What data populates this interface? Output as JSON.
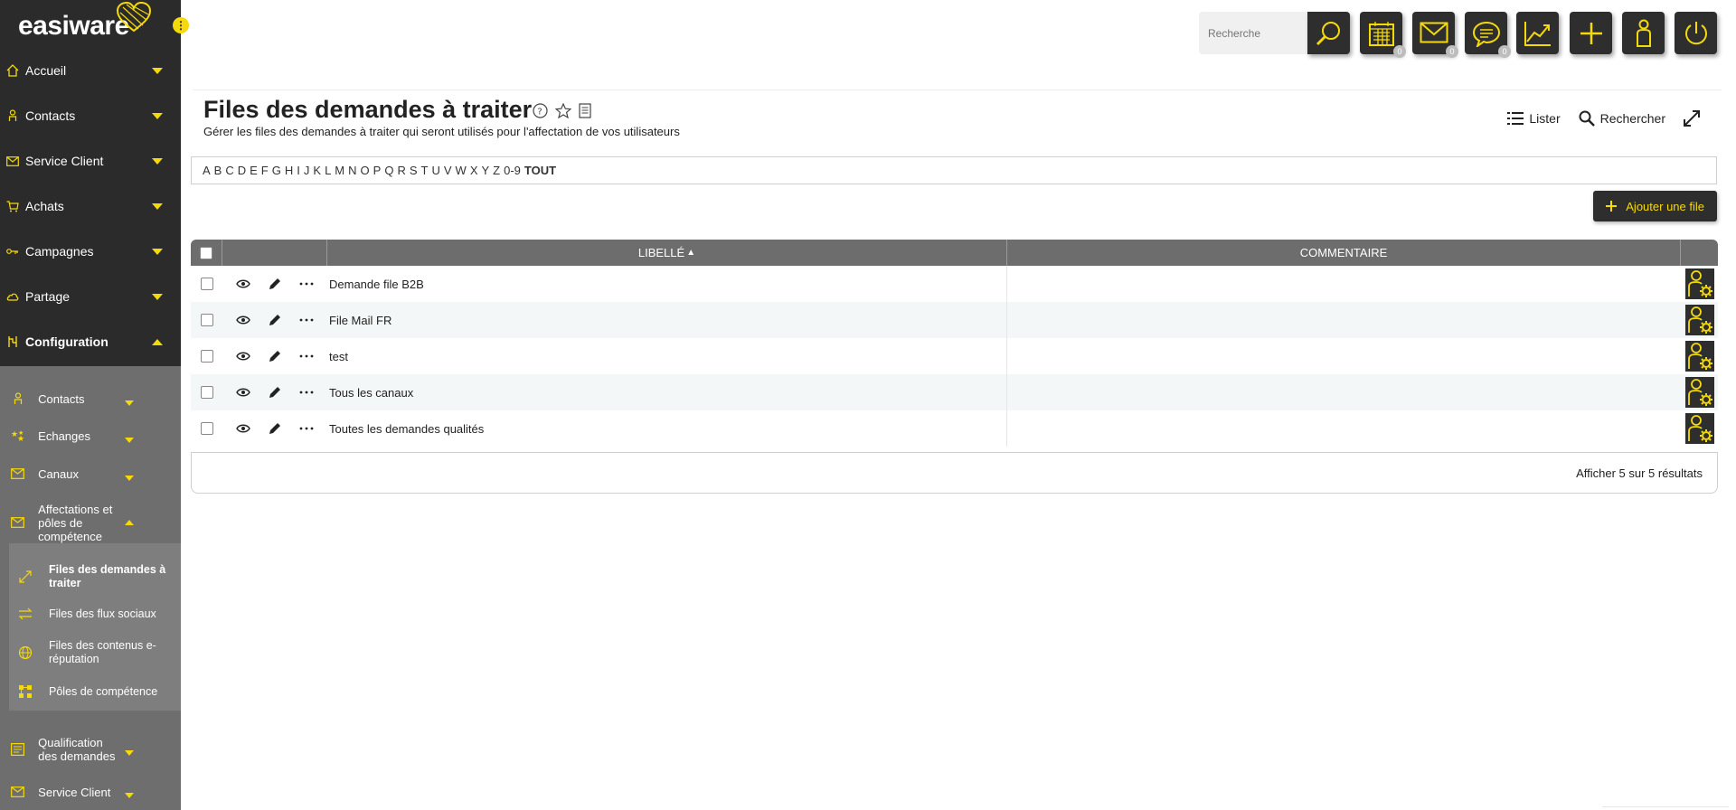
{
  "app": {
    "logo": "easiware"
  },
  "sidebar": {
    "items": [
      {
        "label": "Accueil",
        "icon": "home-icon"
      },
      {
        "label": "Contacts",
        "icon": "person-icon"
      },
      {
        "label": "Service Client",
        "icon": "mail-icon"
      },
      {
        "label": "Achats",
        "icon": "cart-icon"
      },
      {
        "label": "Campagnes",
        "icon": "key-icon"
      },
      {
        "label": "Partage",
        "icon": "cloud-icon"
      },
      {
        "label": "Configuration",
        "icon": "config-icon"
      }
    ],
    "config_items": [
      {
        "label": "Contacts"
      },
      {
        "label": "Echanges"
      },
      {
        "label": "Canaux"
      },
      {
        "label": "Affectations et pôles de compétence"
      },
      {
        "label": "Qualification des demandes"
      },
      {
        "label": "Service Client"
      }
    ],
    "affectation_items": [
      {
        "label": "Files des demandes à traiter"
      },
      {
        "label": "Files des flux sociaux"
      },
      {
        "label": "Files des contenus e-réputation"
      },
      {
        "label": "Pôles de compétence"
      }
    ]
  },
  "topbar": {
    "search_placeholder": "Recherche",
    "badges": {
      "agenda": "0",
      "mail": "0",
      "chat": "0"
    }
  },
  "header": {
    "title": "Files des demandes à traiter",
    "subtitle": "Gérer les files des demandes à traiter qui seront utilisés pour l'affectation de vos utilisateurs",
    "list_label": "Lister",
    "search_label": "Rechercher"
  },
  "alphabet": [
    "A",
    "B",
    "C",
    "D",
    "E",
    "F",
    "G",
    "H",
    "I",
    "J",
    "K",
    "L",
    "M",
    "N",
    "O",
    "P",
    "Q",
    "R",
    "S",
    "T",
    "U",
    "V",
    "W",
    "X",
    "Y",
    "Z",
    "0-9"
  ],
  "alphabet_all": "TOUT",
  "add_button": "Ajouter une file",
  "table": {
    "columns": {
      "label": "LIBELLÉ",
      "comment": "COMMENTAIRE"
    },
    "rows": [
      {
        "label": "Demande file B2B",
        "comment": ""
      },
      {
        "label": "File Mail FR",
        "comment": ""
      },
      {
        "label": "test",
        "comment": ""
      },
      {
        "label": "Tous les canaux",
        "comment": ""
      },
      {
        "label": "Toutes les demandes qualités",
        "comment": ""
      }
    ],
    "footer": "Afficher 5 sur 5 résultats"
  },
  "colors": {
    "accent": "#f5d90a",
    "sidebar": "#2b2b2b",
    "dark_button": "#2e2e2e"
  }
}
